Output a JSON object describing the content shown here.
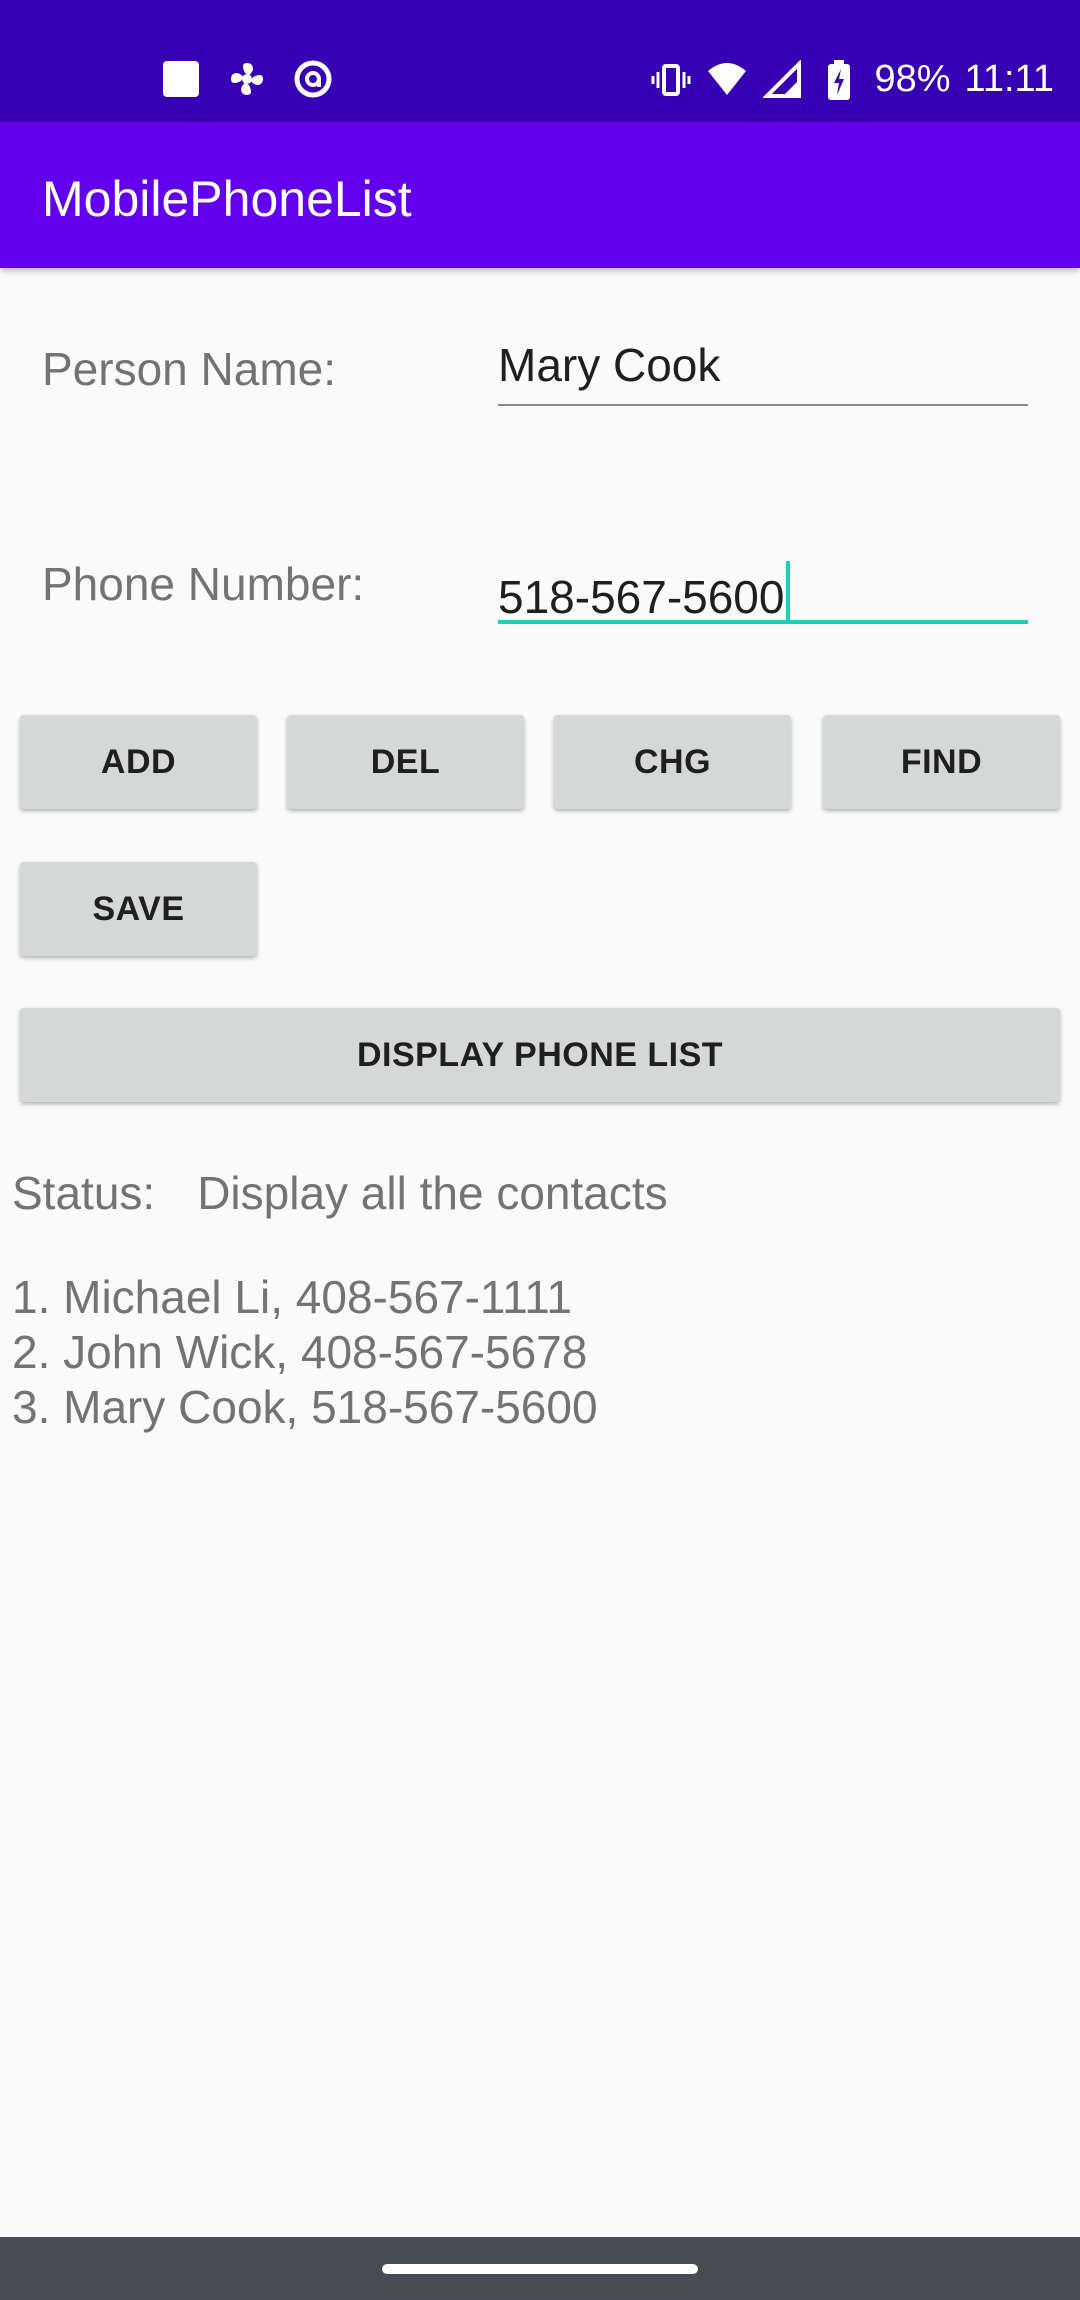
{
  "status_bar": {
    "battery": "98%",
    "time": "11:11",
    "left_icons": [
      "square-notification-icon",
      "fan-notification-icon",
      "at-sync-icon"
    ],
    "right_icons": [
      "vibrate-icon",
      "wifi-icon",
      "cell-signal-icon",
      "battery-charging-icon"
    ]
  },
  "app_bar": {
    "title": "MobilePhoneList"
  },
  "form": {
    "person_name_label": "Person Name:",
    "person_name_value": "Mary Cook",
    "phone_number_label": "Phone Number:",
    "phone_number_value": "518-567-5600"
  },
  "buttons": {
    "add": "ADD",
    "del": "DEL",
    "chg": "CHG",
    "find": "FIND",
    "save": "SAVE",
    "display": "DISPLAY PHONE LIST"
  },
  "status": {
    "label": "Status:",
    "message": "Display all the contacts"
  },
  "contacts": [
    "1. Michael Li, 408-567-1111",
    "2. John Wick, 408-567-5678",
    "3. Mary Cook, 518-567-5600"
  ],
  "colors": {
    "status_bar": "#3700b3",
    "app_bar": "#6200ee",
    "accent": "#1fcfb8",
    "button": "#d6d7d7",
    "nav_bar": "#474d53"
  }
}
